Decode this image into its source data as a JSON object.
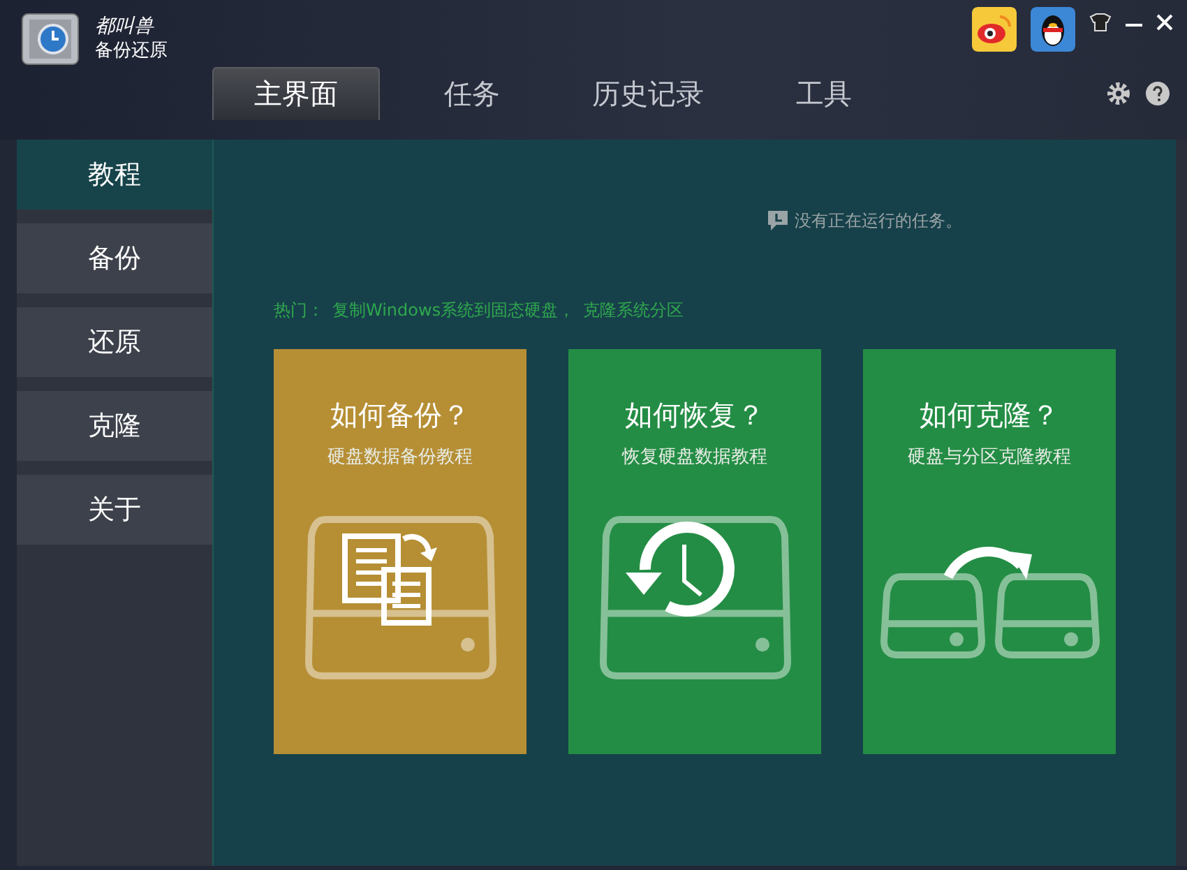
{
  "app": {
    "brand": "都叫兽",
    "title": "备份还原"
  },
  "tabs": [
    {
      "label": "主界面",
      "selected": true
    },
    {
      "label": "任务",
      "selected": false
    },
    {
      "label": "历史记录",
      "selected": false
    },
    {
      "label": "工具",
      "selected": false
    }
  ],
  "sidebar": {
    "items": [
      {
        "label": "教程",
        "selected": true
      },
      {
        "label": "备份",
        "selected": false
      },
      {
        "label": "还原",
        "selected": false
      },
      {
        "label": "克隆",
        "selected": false
      },
      {
        "label": "关于",
        "selected": false
      }
    ]
  },
  "status": "没有正在运行的任务。",
  "hot": {
    "label": "热门：",
    "links": [
      "复制Windows系统到固态硬盘，",
      "克隆系统分区"
    ]
  },
  "cards": [
    {
      "kind": "backup",
      "title": "如何备份？",
      "subtitle": "硬盘数据备份教程",
      "color": "#b68f35"
    },
    {
      "kind": "restore",
      "title": "如何恢复？",
      "subtitle": "恢复硬盘数据教程",
      "color": "#248d45"
    },
    {
      "kind": "clone",
      "title": "如何克隆？",
      "subtitle": "硬盘与分区克隆教程",
      "color": "#248d45"
    }
  ]
}
